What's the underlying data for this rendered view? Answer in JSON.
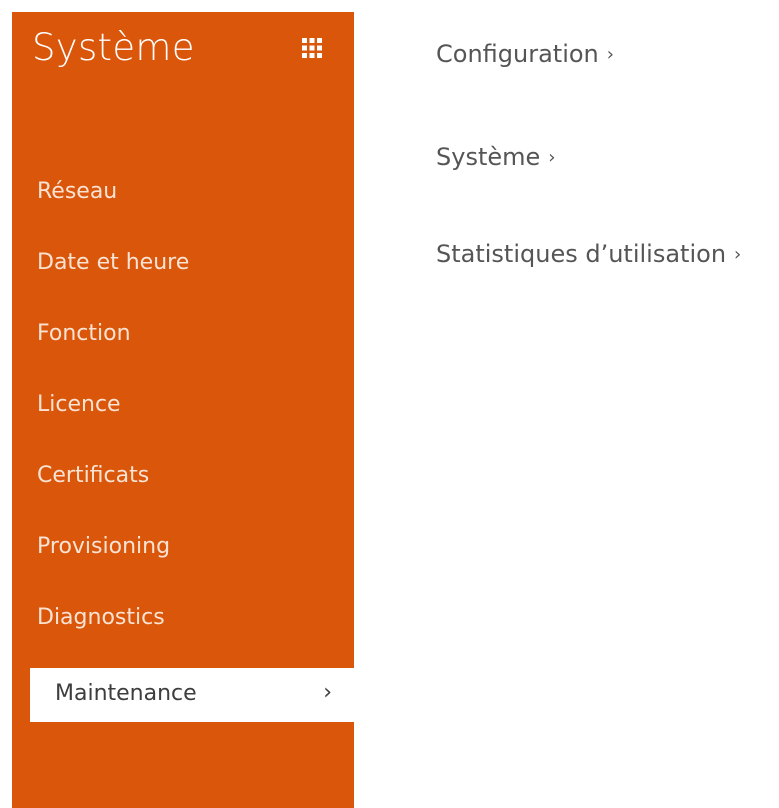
{
  "sidebar": {
    "title": "Système",
    "grid_icon": "grid-icon",
    "accent_color": "#d9560b",
    "items": [
      {
        "label": "Réseau"
      },
      {
        "label": "Date et heure"
      },
      {
        "label": "Fonction"
      },
      {
        "label": "Licence"
      },
      {
        "label": "Certificats"
      },
      {
        "label": "Provisioning"
      },
      {
        "label": "Diagnostics"
      },
      {
        "label": "Maintenance",
        "active": true,
        "chevron": "›"
      }
    ]
  },
  "main": {
    "links": [
      {
        "label": "Configuration",
        "chevron": "›"
      },
      {
        "label": "Système",
        "chevron": "›"
      },
      {
        "label": "Statistiques d’utilisation",
        "chevron": "›"
      }
    ]
  }
}
